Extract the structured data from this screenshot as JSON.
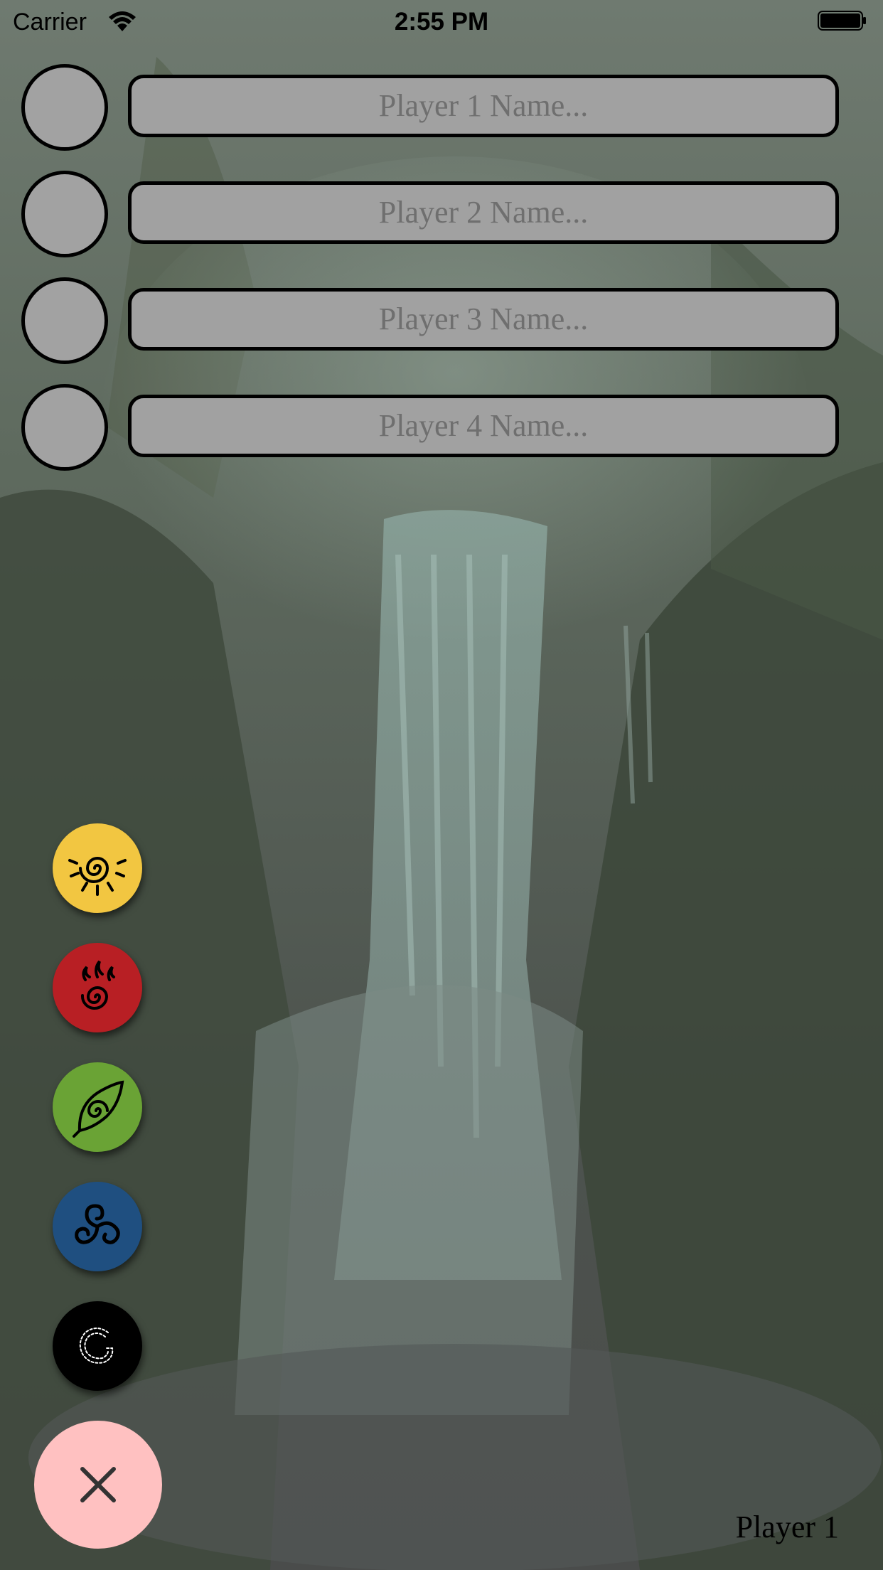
{
  "status_bar": {
    "carrier": "Carrier",
    "time": "2:55 PM"
  },
  "players": [
    {
      "placeholder": "Player 1 Name..."
    },
    {
      "placeholder": "Player 2 Name..."
    },
    {
      "placeholder": "Player 3 Name..."
    },
    {
      "placeholder": "Player 4 Name..."
    }
  ],
  "element_buttons": [
    {
      "icon": "sun-spiral-icon",
      "color": "#f2c641"
    },
    {
      "icon": "flame-spiral-icon",
      "color": "#b81f24"
    },
    {
      "icon": "leaf-spiral-icon",
      "color": "#6aa335"
    },
    {
      "icon": "triskelion-icon",
      "color": "#1f4f80"
    },
    {
      "icon": "void-circle-icon",
      "color": "#000000"
    }
  ],
  "close_button": {
    "icon": "close-icon",
    "color": "#ffc1c1"
  },
  "current_player": "Player 1"
}
